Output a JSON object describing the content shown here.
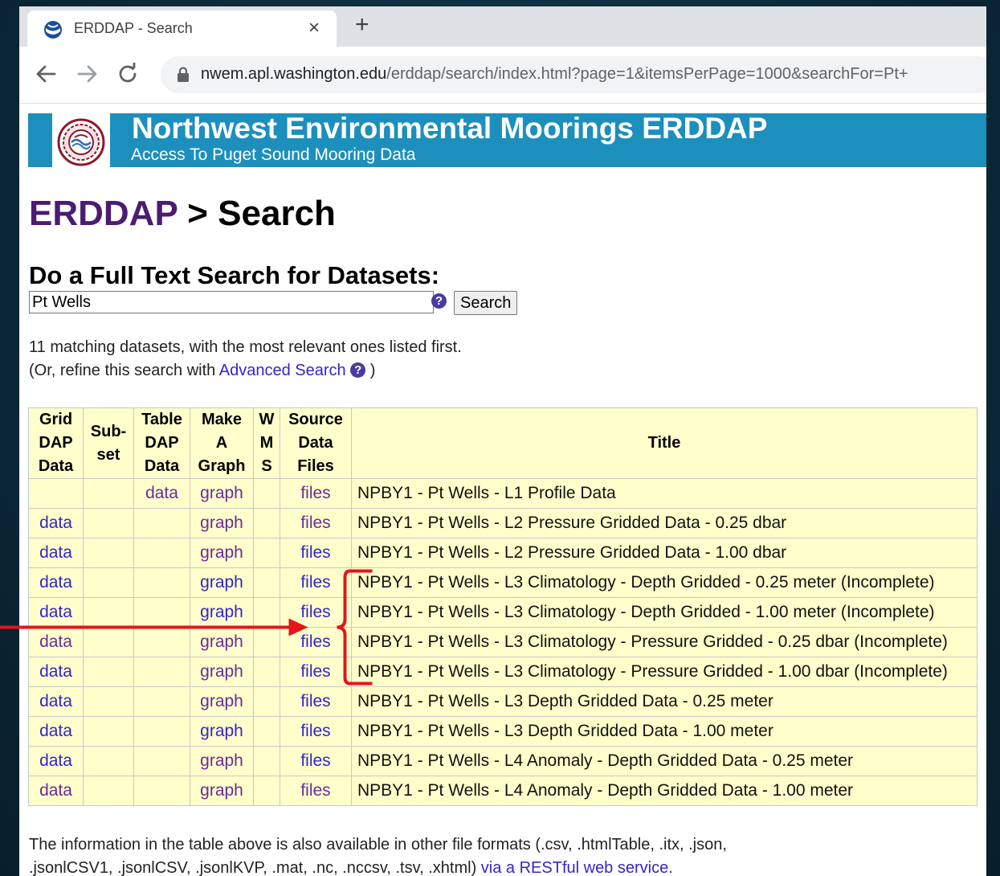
{
  "browser": {
    "tab_title": "ERDDAP - Search",
    "tab_close": "×",
    "new_tab": "+",
    "url_domain": "nwem.apl.washington.edu",
    "url_path": "/erddap/search/index.html?page=1&itemsPerPage=1000&searchFor=Pt+"
  },
  "banner": {
    "title": "Northwest Environmental Moorings ERDDAP",
    "subtitle": "Access To Puget Sound Mooring Data"
  },
  "heading": {
    "erddap": "ERDDAP",
    "rest": " > Search"
  },
  "search": {
    "heading": "Do a Full Text Search for Datasets:",
    "value": "Pt Wells",
    "button_label": "Search",
    "help": "?"
  },
  "results_info": {
    "count_text": "11 matching datasets, with the most relevant ones listed first.",
    "refine_prefix": "(Or, refine this search with ",
    "refine_link": "Advanced Search",
    "refine_suffix": " )"
  },
  "table": {
    "headers": {
      "griddap": [
        "Grid",
        "DAP",
        "Data"
      ],
      "subset": [
        "Sub-",
        "set"
      ],
      "tabledap": [
        "Table",
        "DAP",
        "Data"
      ],
      "graph": [
        "Make",
        "A",
        "Graph"
      ],
      "wms": [
        "W",
        "M",
        "S"
      ],
      "files": [
        "Source",
        "Data",
        "Files"
      ],
      "title": "Title"
    },
    "rows": [
      {
        "griddap": "",
        "subset": "",
        "tabledap": "data",
        "graph": "graph",
        "wms": "",
        "files": "files",
        "title": "NPBY1 - Pt Wells - L1 Profile Data"
      },
      {
        "griddap": "data",
        "subset": "",
        "tabledap": "",
        "graph": "graph",
        "wms": "",
        "files": "files",
        "title": "NPBY1 - Pt Wells - L2 Pressure Gridded Data - 0.25 dbar"
      },
      {
        "griddap": "data",
        "subset": "",
        "tabledap": "",
        "graph": "graph",
        "wms": "",
        "files": "files",
        "title": "NPBY1 - Pt Wells - L2 Pressure Gridded Data - 1.00 dbar"
      },
      {
        "griddap": "data",
        "subset": "",
        "tabledap": "",
        "graph": "graph",
        "wms": "",
        "files": "files",
        "title": "NPBY1 - Pt Wells - L3 Climatology - Depth Gridded - 0.25 meter (Incomplete)"
      },
      {
        "griddap": "data",
        "subset": "",
        "tabledap": "",
        "graph": "graph",
        "wms": "",
        "files": "files",
        "title": "NPBY1 - Pt Wells - L3 Climatology - Depth Gridded - 1.00 meter (Incomplete)"
      },
      {
        "griddap": "data",
        "subset": "",
        "tabledap": "",
        "graph": "graph",
        "wms": "",
        "files": "files",
        "title": "NPBY1 - Pt Wells - L3 Climatology - Pressure Gridded - 0.25 dbar (Incomplete)"
      },
      {
        "griddap": "data",
        "subset": "",
        "tabledap": "",
        "graph": "graph",
        "wms": "",
        "files": "files",
        "title": "NPBY1 - Pt Wells - L3 Climatology - Pressure Gridded - 1.00 dbar (Incomplete)"
      },
      {
        "griddap": "data",
        "subset": "",
        "tabledap": "",
        "graph": "graph",
        "wms": "",
        "files": "files",
        "title": "NPBY1 - Pt Wells - L3 Depth Gridded Data - 0.25 meter"
      },
      {
        "griddap": "data",
        "subset": "",
        "tabledap": "",
        "graph": "graph",
        "wms": "",
        "files": "files",
        "title": "NPBY1 - Pt Wells - L3 Depth Gridded Data - 1.00 meter"
      },
      {
        "griddap": "data",
        "subset": "",
        "tabledap": "",
        "graph": "graph",
        "wms": "",
        "files": "files",
        "title": "NPBY1 - Pt Wells - L4 Anomaly - Depth Gridded Data - 0.25 meter"
      },
      {
        "griddap": "data",
        "subset": "",
        "tabledap": "",
        "graph": "graph",
        "wms": "",
        "files": "files",
        "title": "NPBY1 - Pt Wells - L4 Anomaly - Depth Gridded Data - 1.00 meter"
      }
    ],
    "visited_links": [
      "0.tabledap",
      "0.graph",
      "0.files",
      "1.graph",
      "1.files",
      "2.graph",
      "5.griddap",
      "5.graph",
      "6.graph",
      "7.graph",
      "9.graph",
      "10.griddap",
      "10.graph",
      "10.files"
    ]
  },
  "footer": {
    "line1": "The information in the table above is also available in other file formats (.csv, .htmlTable, .itx, .json,",
    "line2_prefix": ".jsonlCSV1, .jsonlCSV, .jsonlKVP, .mat, .nc, .nccsv, .tsv, .xhtml) ",
    "line2_link": "via a RESTful web service."
  },
  "annotation": {
    "color": "#e3161b",
    "highlighted_rows": [
      3,
      4,
      5,
      6
    ]
  },
  "colors": {
    "banner": "#1d8fbd",
    "table_background": "#ffffcc",
    "link": "#3325c9",
    "visited_link": "#6a2c9a",
    "erddap_heading": "#4b1c72"
  }
}
